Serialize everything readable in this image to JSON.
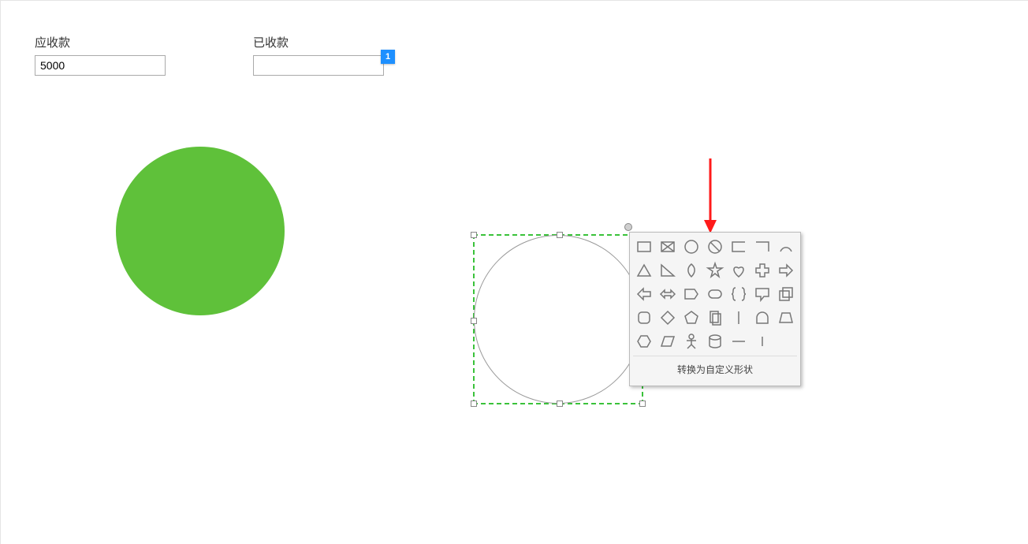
{
  "fields": {
    "receivable": {
      "label": "应收款",
      "value": "5000"
    },
    "received": {
      "label": "已收款",
      "value": ""
    }
  },
  "badge": "1",
  "shapes_panel": {
    "convert_label": "转换为自定义形状",
    "items": [
      "rectangle-icon",
      "crossed-rectangle-icon",
      "circle-icon",
      "disallow-icon",
      "open-rect-icon",
      "half-rect-icon",
      "arc-icon",
      "triangle-icon",
      "right-triangle-icon",
      "teardrop-icon",
      "star-icon",
      "heart-icon",
      "plus-icon",
      "arrow-right-icon",
      "arrow-left-icon",
      "arrow-leftright-icon",
      "d-tag-icon",
      "round-rect-icon",
      "brace-icon",
      "callout-icon",
      "stack-icon",
      "rounded-square-icon",
      "diamond-icon",
      "pentagon-icon",
      "pages-icon",
      "vertical-line-icon",
      "dome-icon",
      "trapezoid-icon",
      "hexagon-icon",
      "parallelogram-icon",
      "actor-icon",
      "cylinder-icon",
      "horizontal-line-icon",
      "vertical-short-icon",
      "blank-icon"
    ]
  },
  "colors": {
    "green": "#5fc13a",
    "selection": "#3ac23a",
    "badge": "#1e90ff"
  }
}
